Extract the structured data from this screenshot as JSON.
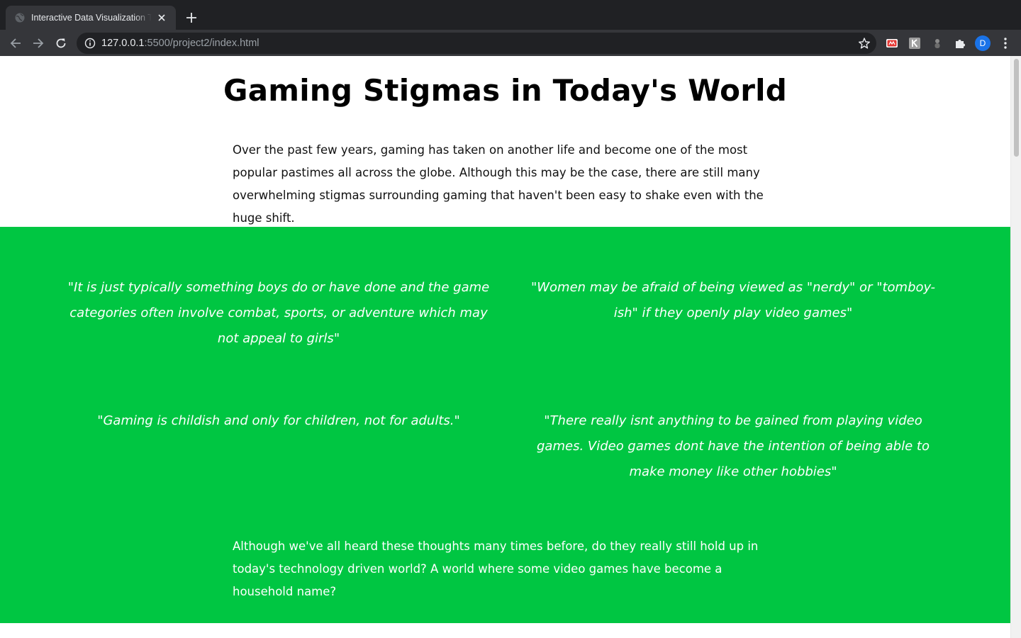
{
  "browser": {
    "tab": {
      "title": "Interactive Data Visualization T",
      "favicon": "globe-icon",
      "close_icon": "close-icon"
    },
    "new_tab_icon": "plus-icon",
    "toolbar": {
      "back_icon": "back-arrow-icon",
      "forward_icon": "forward-arrow-icon",
      "reload_icon": "reload-icon",
      "url_host": "127.0.0.1",
      "url_rest": ":5500/project2/index.html",
      "bookmark_icon": "star-icon",
      "extensions": [
        "red-extension-icon",
        "k-extension-icon",
        "gray-extension-icon",
        "puzzle-icon"
      ],
      "profile_initial": "D",
      "menu_icon": "more-vertical-icon"
    }
  },
  "page": {
    "title": "Gaming Stigmas in Today's World",
    "intro": "Over the past few years, gaming has taken on another life and become one of the most popular pastimes all across the globe. Although this may be the case, there are still many overwhelming stigmas surrounding gaming that haven't been easy to shake even with the huge shift.",
    "quotes": [
      "\"It is just typically something boys do or have done and the game categories often involve combat, sports, or adventure which may not appeal to girls\"",
      "\"Women may be afraid of being viewed as \"nerdy\" or \"tomboy-ish\" if they openly play video games\"",
      "\"Gaming is childish and only for children, not for adults.\"",
      "\"There really isnt anything to be gained from playing video games. Video games dont have the intention of being able to make money like other hobbies\""
    ],
    "outro": "Although we've all heard these thoughts many times before, do they really still hold up in today's technology driven world? A world where some video games have become a household name?"
  },
  "colors": {
    "accent_green": "#00c642",
    "chrome_dark": "#202124",
    "chrome_tab": "#35363a",
    "profile_blue": "#1a73e8"
  }
}
